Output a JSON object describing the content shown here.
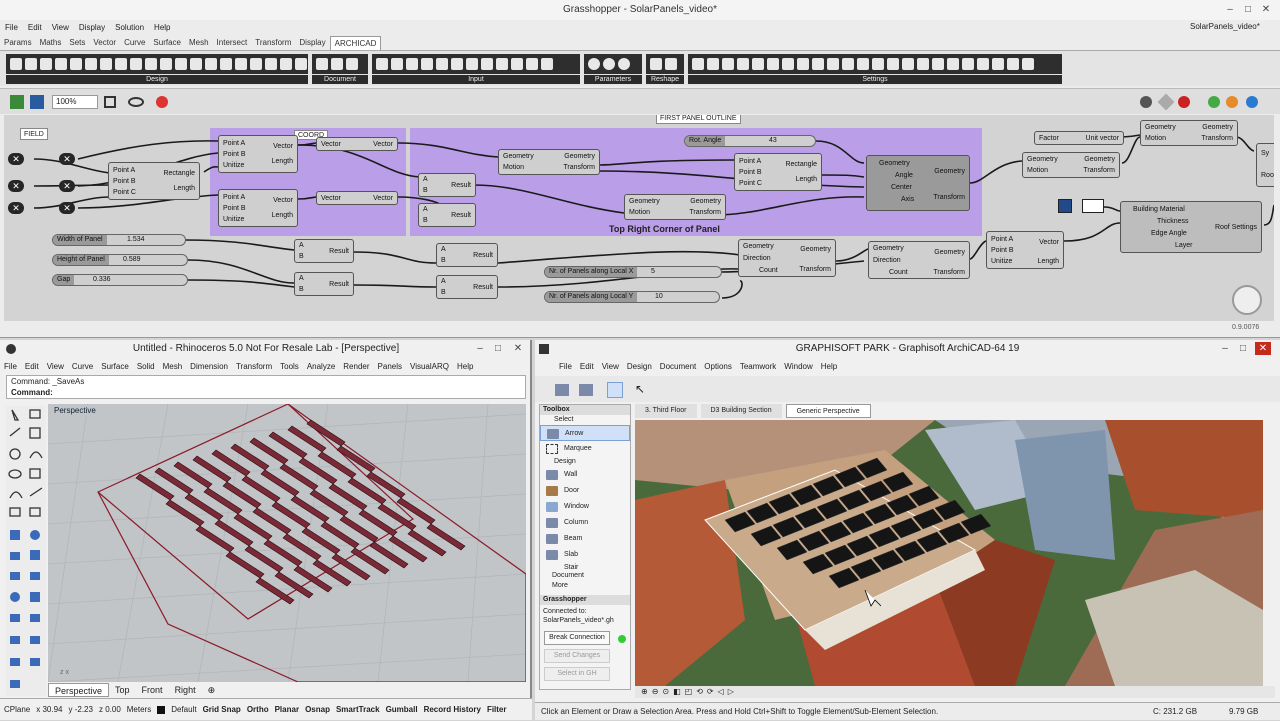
{
  "gh": {
    "title": "Grasshopper - SolarPanels_video*",
    "doc_name": "SolarPanels_video*",
    "menu": [
      "File",
      "Edit",
      "View",
      "Display",
      "Solution",
      "Help"
    ],
    "tabs": [
      "Params",
      "Maths",
      "Sets",
      "Vector",
      "Curve",
      "Surface",
      "Mesh",
      "Intersect",
      "Transform",
      "Display",
      "ARCHICAD"
    ],
    "ribbon_groups": [
      "Design",
      "Document",
      "Input",
      "Parameters",
      "Reshape",
      "Settings"
    ],
    "zoom": "100%",
    "field_label": "FIELD",
    "first_panel_label": "FIRST PANEL OUTLINE",
    "group_caption": "Top Right Corner of Panel",
    "version": "0.9.0076",
    "sliders": {
      "width_name": "Width of Panel",
      "width_val": "1.534",
      "height_name": "Height of Panel",
      "height_val": "0.589",
      "gap_name": "Gap",
      "gap_val": "0.336",
      "rot_name": "Rot. Angle",
      "rot_val": "43",
      "nx_name": "Nr. of Panels along Local X",
      "nx_val": "5",
      "ny_name": "Nr. of Panels along Local Y",
      "ny_val": "10"
    },
    "labels": {
      "point_a": "Point A",
      "point_b": "Point B",
      "point_c": "Point C",
      "rectangle": "Rectangle",
      "length": "Length",
      "vector": "Vector",
      "unitize": "Unitize",
      "geometry": "Geometry",
      "motion": "Motion",
      "transform": "Transform",
      "result": "Result",
      "a": "A",
      "b": "B",
      "angle": "Angle",
      "center": "Center",
      "axis": "Axis",
      "direction": "Direction",
      "count": "Count",
      "factor": "Factor",
      "unit_vector": "Unit vector",
      "building_material": "Building Material",
      "thickness": "Thickness",
      "edge_angle": "Edge Angle",
      "layer": "Layer",
      "roof_settings": "Roof Settings",
      "coord": "COORD",
      "sy": "Sy",
      "roo": "Roo"
    }
  },
  "rhino": {
    "title": "Untitled - Rhinoceros 5.0 Not For Resale Lab - [Perspective]",
    "menu": [
      "File",
      "Edit",
      "View",
      "Curve",
      "Surface",
      "Solid",
      "Mesh",
      "Dimension",
      "Transform",
      "Tools",
      "Analyze",
      "Render",
      "Panels",
      "VisualARQ",
      "Help"
    ],
    "command_history": "Command: _SaveAs",
    "command_prompt": "Command:",
    "viewport_label": "Perspective",
    "view_tabs": [
      "Perspective",
      "Top",
      "Front",
      "Right"
    ],
    "status": {
      "cplane": "CPlane",
      "x": "x 30.94",
      "y": "y -2.23",
      "z": "z 0.00",
      "units": "Meters",
      "layer": "Default",
      "toggles": [
        "Grid Snap",
        "Ortho",
        "Planar",
        "Osnap",
        "SmartTrack",
        "Gumball",
        "Record History",
        "Filter"
      ]
    }
  },
  "archicad": {
    "title": "GRAPHISOFT PARK - Graphisoft ArchiCAD-64 19",
    "menu": [
      "File",
      "Edit",
      "View",
      "Design",
      "Document",
      "Options",
      "Teamwork",
      "Window",
      "Help"
    ],
    "toolbox_header": "Toolbox",
    "select_header": "Select",
    "select_items": [
      "Arrow",
      "Marquee"
    ],
    "design_header": "Design",
    "design_items": [
      "Wall",
      "Door",
      "Window",
      "Column",
      "Beam",
      "Slab",
      "Stair"
    ],
    "document_item": "Document",
    "more_item": "More",
    "gh_panel_header": "Grasshopper",
    "connected_to": "Connected to:",
    "connected_file": "SolarPanels_video*.gh",
    "break_connection": "Break Connection",
    "send_changes": "Send Changes",
    "select_in_gh": "Select in GH",
    "tabs": [
      "3. Third Floor",
      "D3 Building Section",
      "Generic Perspective"
    ],
    "status_text": "Click an Element or Draw a Selection Area. Press and Hold Ctrl+Shift to Toggle Element/Sub-Element Selection.",
    "disk_c": "C: 231.2 GB",
    "mem": "9.79 GB"
  }
}
